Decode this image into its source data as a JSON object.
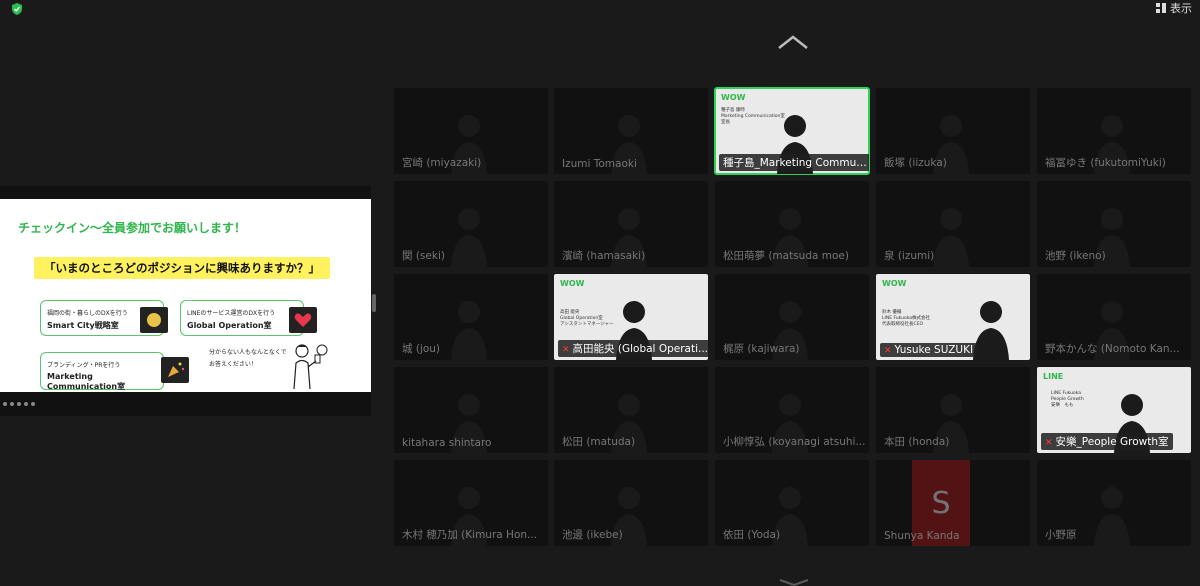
{
  "toolbar": {
    "view_label": "表示"
  },
  "shared_slide": {
    "title": "チェックイン〜全員参加でお願いします！",
    "question": "「いまのところどのポジションに興味ありますか？」",
    "cards": [
      {
        "sub": "福岡の街・暮らしのDXを行う",
        "main": "Smart City戦略室"
      },
      {
        "sub": "LINEのサービス運営のDXを行う",
        "main": "Global Operation室"
      },
      {
        "sub": "ブランディング・PRを行う",
        "main": "Marketing Communication室"
      }
    ],
    "note_line1": "分からない人もなんとなくで",
    "note_line2": "お答えください！"
  },
  "participants": [
    {
      "name": "宮崎 (miyazaki)",
      "style": "dim"
    },
    {
      "name": "Izumi Tomaoki",
      "style": "dim"
    },
    {
      "name": "種子島_Marketing Communi...",
      "style": "bright",
      "active": true,
      "logo": "WOW",
      "caption1": "種子島 康時",
      "caption2": "Marketing Communication室",
      "caption3": "室長"
    },
    {
      "name": "飯塚 (iizuka)",
      "style": "dim"
    },
    {
      "name": "福冨ゆき (fukutomiYuki)",
      "style": "dim"
    },
    {
      "name": "関 (seki)",
      "style": "dim"
    },
    {
      "name": "濱崎 (hamasaki)",
      "style": "dim"
    },
    {
      "name": "松田萌夢 (matsuda moe)",
      "style": "dim"
    },
    {
      "name": "泉 (izumi)",
      "style": "dim"
    },
    {
      "name": "池野 (ikeno)",
      "style": "dim"
    },
    {
      "name": "城 (jou)",
      "style": "dim"
    },
    {
      "name": "高田能央 (Global Operati...",
      "style": "bright",
      "muted": true,
      "logo": "WOW",
      "caption1": "高田 能央",
      "caption2": "Global Operation室",
      "caption3": "アシスタントマネージャー"
    },
    {
      "name": "梶原 (kajiwara)",
      "style": "dim"
    },
    {
      "name": "Yusuke SUZUKI",
      "style": "bright",
      "muted": true,
      "logo": "WOW",
      "caption1": "鈴木 優輔",
      "caption2": "LINE Fukuoka株式会社",
      "caption3": "代表取締役社長CEO"
    },
    {
      "name": "野本かんな (Nomoto Kan...",
      "style": "dim"
    },
    {
      "name": "kitahara shintaro",
      "style": "dim"
    },
    {
      "name": "松田 (matuda)",
      "style": "dim"
    },
    {
      "name": "小柳惇弘 (koyanagi atsuhi...",
      "style": "dim"
    },
    {
      "name": "本田 (honda)",
      "style": "dim"
    },
    {
      "name": "安樂_People Growth室",
      "style": "bright",
      "muted": true,
      "logo": "LINE",
      "caption1": "LINE Fukuoka",
      "caption2": "People Growth",
      "caption3": "安樂　もも"
    },
    {
      "name": "木村 穂乃加 (Kimura Hon...",
      "style": "dim"
    },
    {
      "name": "池邊 (ikebe)",
      "style": "dim"
    },
    {
      "name": "依田 (Yoda)",
      "style": "dim"
    },
    {
      "name": "Shunya Kanda",
      "style": "dim",
      "initial": "S"
    },
    {
      "name": "小野原",
      "style": "dim"
    }
  ]
}
